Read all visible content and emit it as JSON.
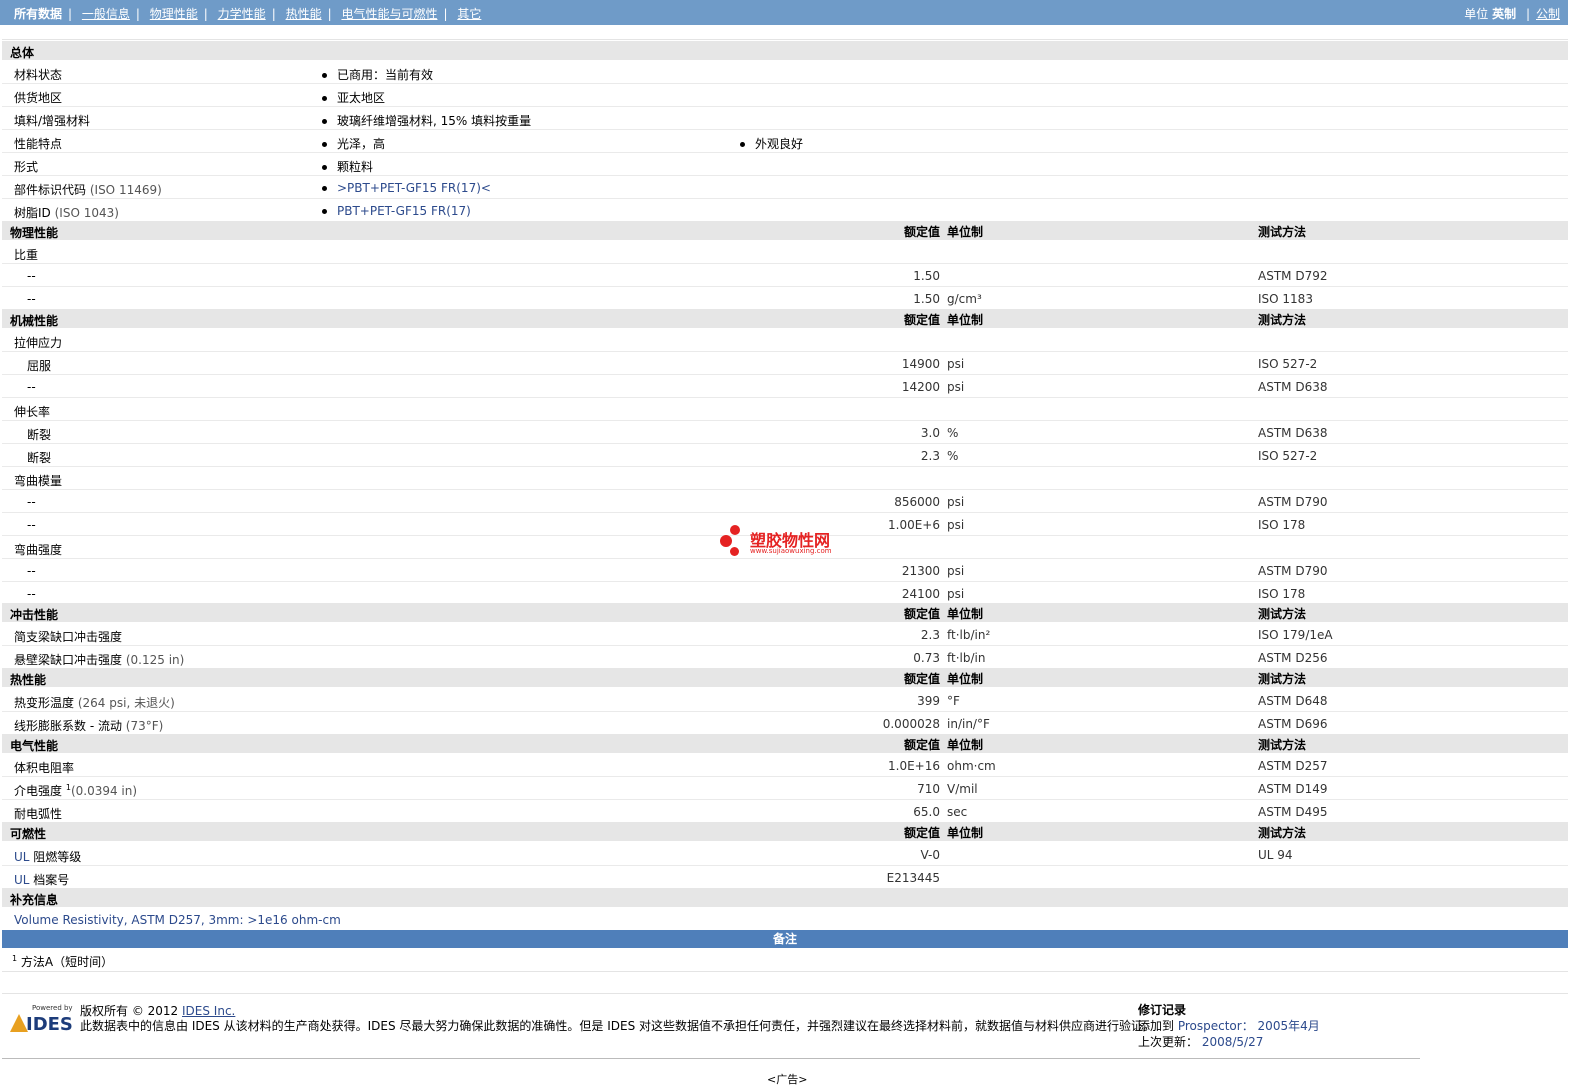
{
  "nav": {
    "items": [
      "所有数据",
      "一般信息",
      "物理性能",
      "力学性能",
      "热性能",
      "电气性能与可燃性",
      "其它"
    ],
    "units_label": "单位",
    "unit_imperial": "英制",
    "unit_metric": "公制"
  },
  "general": {
    "title": "总体",
    "rows": [
      {
        "label": "材料状态",
        "b1": "已商用：当前有效",
        "b2": ""
      },
      {
        "label": "供货地区",
        "b1": "亚太地区",
        "b2": ""
      },
      {
        "label": "填料/增强材料",
        "b1": "玻璃纤维增强材料, 15% 填料按重量",
        "b2": ""
      },
      {
        "label": "性能特点",
        "b1": "光泽，高",
        "b2": "外观良好"
      },
      {
        "label": "形式",
        "b1": "颗粒料",
        "b2": ""
      },
      {
        "label": "部件标识代码",
        "label_note": "(ISO 11469)",
        "b1": ">PBT+PET-GF15 FR(17)<",
        "b2": ""
      },
      {
        "label": "树脂ID",
        "label_note": "(ISO 1043)",
        "b1": "PBT+PET-GF15 FR(17)",
        "b2": ""
      }
    ]
  },
  "headers": {
    "val": "额定值",
    "unit": "单位制",
    "method": "测试方法"
  },
  "physical": {
    "title": "物理性能",
    "group": "比重",
    "rows": [
      {
        "sub": "--",
        "val": "1.50",
        "unit": "",
        "method": "ASTM D792"
      },
      {
        "sub": "--",
        "val": "1.50",
        "unit": "g/cm³",
        "method": "ISO 1183"
      }
    ]
  },
  "mechanical": {
    "title": "机械性能",
    "g1": "拉伸应力",
    "g1rows": [
      {
        "sub": "屈服",
        "val": "14900",
        "unit": "psi",
        "method": "ISO 527-2"
      },
      {
        "sub": "--",
        "val": "14200",
        "unit": "psi",
        "method": "ASTM D638"
      }
    ],
    "g2": "伸长率",
    "g2rows": [
      {
        "sub": "断裂",
        "val": "3.0",
        "unit": "%",
        "method": "ASTM D638"
      },
      {
        "sub": "断裂",
        "val": "2.3",
        "unit": "%",
        "method": "ISO 527-2"
      }
    ],
    "g3": "弯曲模量",
    "g3rows": [
      {
        "sub": "--",
        "val": "856000",
        "unit": "psi",
        "method": "ASTM D790"
      },
      {
        "sub": "--",
        "val": "1.00E+6",
        "unit": "psi",
        "method": "ISO 178"
      }
    ],
    "g4": "弯曲强度",
    "g4rows": [
      {
        "sub": "--",
        "val": "21300",
        "unit": "psi",
        "method": "ASTM D790"
      },
      {
        "sub": "--",
        "val": "24100",
        "unit": "psi",
        "method": "ISO 178"
      }
    ]
  },
  "impact": {
    "title": "冲击性能",
    "rows": [
      {
        "label": "简支梁缺口冲击强度",
        "note": "",
        "val": "2.3",
        "unit": "ft·lb/in²",
        "method": "ISO 179/1eA"
      },
      {
        "label": "悬壁梁缺口冲击强度",
        "note": "(0.125 in)",
        "val": "0.73",
        "unit": "ft·lb/in",
        "method": "ASTM D256"
      }
    ]
  },
  "thermal": {
    "title": "热性能",
    "rows": [
      {
        "label": "热变形温度",
        "note": "(264 psi, 未退火)",
        "val": "399",
        "unit": "°F",
        "method": "ASTM D648"
      },
      {
        "label": "线形膨胀系数 - 流动",
        "note": "(73°F)",
        "val": "0.000028",
        "unit": "in/in/°F",
        "method": "ASTM D696"
      }
    ]
  },
  "electrical": {
    "title": "电气性能",
    "rows": [
      {
        "label": "体积电阻率",
        "note": "",
        "val": "1.0E+16",
        "unit": "ohm·cm",
        "method": "ASTM D257"
      },
      {
        "label": "介电强度",
        "sup": "1",
        "note": "(0.0394 in)",
        "val": "710",
        "unit": "V/mil",
        "method": "ASTM D149"
      },
      {
        "label": "耐电弧性",
        "note": "",
        "val": "65.0",
        "unit": "sec",
        "method": "ASTM D495"
      }
    ]
  },
  "flammability": {
    "title": "可燃性",
    "rows": [
      {
        "label_pre": "UL",
        "label": " 阻燃等级",
        "val": "V-0",
        "unit": "",
        "method": "UL 94"
      },
      {
        "label_pre": "UL",
        "label": " 档案号",
        "val": "E213445",
        "unit": "",
        "method": ""
      }
    ]
  },
  "supplement": {
    "title": "补充信息",
    "text": "Volume Resistivity, ASTM D257, 3mm: >1e16 ohm-cm"
  },
  "notes": {
    "title": "备注",
    "sup": "1",
    "text": "方法A（短时间）"
  },
  "footer": {
    "logo_small": "Powered by",
    "logo_text": "IDES",
    "copyright_pre": "版权所有 © 2012",
    "company": "IDES Inc.",
    "disclaimer": "此数据表中的信息由 IDES 从该材料的生产商处获得。IDES 尽最大努力确保此数据的准确性。但是 IDES 对这些数据值不承担任何责任，并强烈建议在最终选择材料前，就数据值与材料供应商进行验证。",
    "rev_title": "修订记录",
    "added_label": "添加到",
    "added_target": "Prospector：",
    "added_date": "2005年4月",
    "updated_label": "上次更新：",
    "updated_date": "2008/5/27",
    "ad": "<广告>"
  },
  "watermark": {
    "title": "塑胶物性网",
    "url": "www.sujiaowuxing.com"
  },
  "colors": {
    "topbar": "#6f9bc8",
    "notebar": "#4f7fba",
    "section": "#e6e6e6",
    "link": "#2c4a8c"
  }
}
